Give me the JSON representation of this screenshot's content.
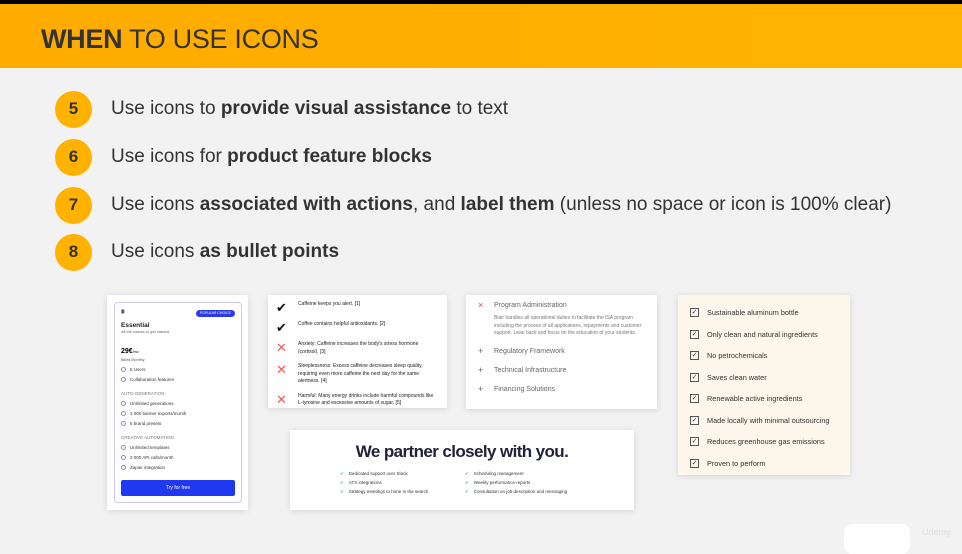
{
  "header": {
    "title_bold": "WHEN",
    "title_rest": " TO USE ICONS"
  },
  "bullets": [
    {
      "num": "5",
      "parts": [
        {
          "t": "Use icons to ",
          "b": false
        },
        {
          "t": "provide visual assistance",
          "b": true
        },
        {
          "t": " to text",
          "b": false
        }
      ]
    },
    {
      "num": "6",
      "parts": [
        {
          "t": "Use icons for ",
          "b": false
        },
        {
          "t": "product feature blocks",
          "b": true
        }
      ]
    },
    {
      "num": "7",
      "parts": [
        {
          "t": "Use icons ",
          "b": false
        },
        {
          "t": "associated with actions",
          "b": true
        },
        {
          "t": ", and ",
          "b": false
        },
        {
          "t": "label them",
          "b": true
        },
        {
          "t": " (unless no space or icon is 100% clear)",
          "b": false
        }
      ]
    },
    {
      "num": "8",
      "parts": [
        {
          "t": "Use icons ",
          "b": false
        },
        {
          "t": "as bullet points",
          "b": true
        }
      ]
    }
  ],
  "pricing": {
    "badge": "POPULAR CHOICE",
    "plan": "Essential",
    "subtitle": "All the basics to get started",
    "price": "29€",
    "per": "/mo",
    "billing": "Billed Monthly",
    "features": [
      "5 Users",
      "Collaboration features"
    ],
    "sections": [
      {
        "title": "AUTO-GENERATION",
        "items": [
          "Unlimited generations",
          "1 000 banner exports/month",
          "5 brand presets"
        ]
      },
      {
        "title": "CREATIVE AUTOMATION",
        "items": [
          "Unlimited templates",
          "2 000 API calls/month",
          "Zapier integration"
        ]
      }
    ],
    "cta": "Try for free"
  },
  "caffeine": [
    {
      "icon": "check",
      "text": "Caffeine keeps you alert. [1]"
    },
    {
      "icon": "x",
      "text": "Coffee contains helpful antioxidants. [2]",
      "iconOverride": "check"
    },
    {
      "icon": "x",
      "text": "Anxiety: Caffeine increases the body's stress hormone (cortisol). [3]"
    },
    {
      "icon": "x",
      "text": "Sleeplessness: Excess caffeine decreases sleep quality, requiring even more caffeine the next day for the same alertness. [4]"
    },
    {
      "icon": "x",
      "text": "Harmful: Many energy drinks include harmful compounds like L-tyrosine and excessive amounts of sugar. [5]"
    }
  ],
  "accordion": {
    "open": {
      "title": "Program Administration",
      "body": "Blair handles all operational duties to facilitate the ISA program including the process of all applications, repayments and customer support. Lean back and focus on the education of your students."
    },
    "closed": [
      "Regulatory Framework",
      "Technical Infrastructure",
      "Financing Solutions"
    ]
  },
  "partner": {
    "title": "We partner closely with you.",
    "left": [
      "Dedicated support over Slack",
      "ATS integrations",
      "Strategy meetings to hone in the search"
    ],
    "right": [
      "Scheduling management",
      "Weekly performance reports",
      "Consultation on job description and messaging"
    ]
  },
  "checklist": [
    "Sustainable aluminum bottle",
    "Only clean and natural ingredients",
    "No petrochemicals",
    "Saves clean water",
    "Renewable active ingredients",
    "Made locally with minimal outsourcing",
    "Reduces greenhouse gas emissions",
    "Proven to perform"
  ],
  "watermark": "Udemy"
}
